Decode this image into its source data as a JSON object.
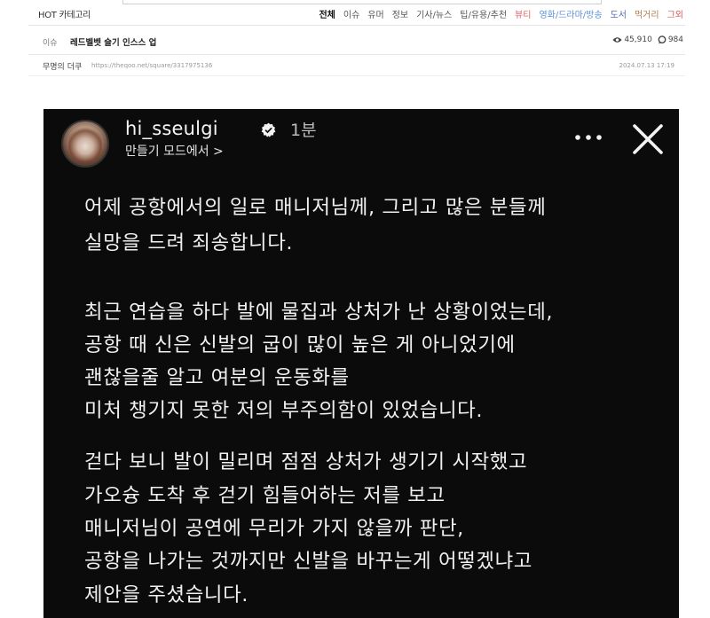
{
  "nav": {
    "hot_label": "HOT 카테고리",
    "tabs": [
      "전체",
      "이슈",
      "유머",
      "정보",
      "기사/뉴스",
      "팁/유용/추천",
      "뷰티",
      "영화/드라마/방송",
      "도서",
      "먹거리",
      "그외"
    ],
    "tab_colors": [
      "#111111",
      "#555555",
      "#555555",
      "#555555",
      "#555555",
      "#555555",
      "#e0606a",
      "#5b8fd6",
      "#5a6bb0",
      "#b07a50",
      "#d9534f"
    ]
  },
  "post": {
    "category": "이슈",
    "title": "레드벨벳 슬기 인스스 업",
    "views": "45,910",
    "comments": "984",
    "author": "무명의 더쿠",
    "url": "https://theqoo.net/square/3317975136",
    "date": "2024.07.13 17:19"
  },
  "story": {
    "username": "hi_sseulgi",
    "time": "1분",
    "subtitle": "만들기 모드에서 >",
    "lines": [
      "어제 공항에서의 일로 매니저님께, 그리고 많은 분들께",
      "실망을 드려 죄송합니다.",
      "최근 연습을 하다 발에 물집과 상처가 난 상황이었는데,",
      "공항 때 신은 신발의 굽이 많이 높은 게 아니었기에",
      "괜찮을줄 알고 여분의 운동화를",
      "미처 챙기지 못한 저의 부주의함이 있었습니다.",
      "걷다 보니 발이 밀리며 점점 상처가 생기기 시작했고",
      "가오슝 도착 후 걷기 힘들어하는 저를 보고",
      "매니저님이 공연에 무리가 가지 않을까 판단,",
      "공항을 나가는 것까지만 신발을 바꾸는게 어떻겠냐고",
      "제안을 주셨습니다."
    ]
  }
}
